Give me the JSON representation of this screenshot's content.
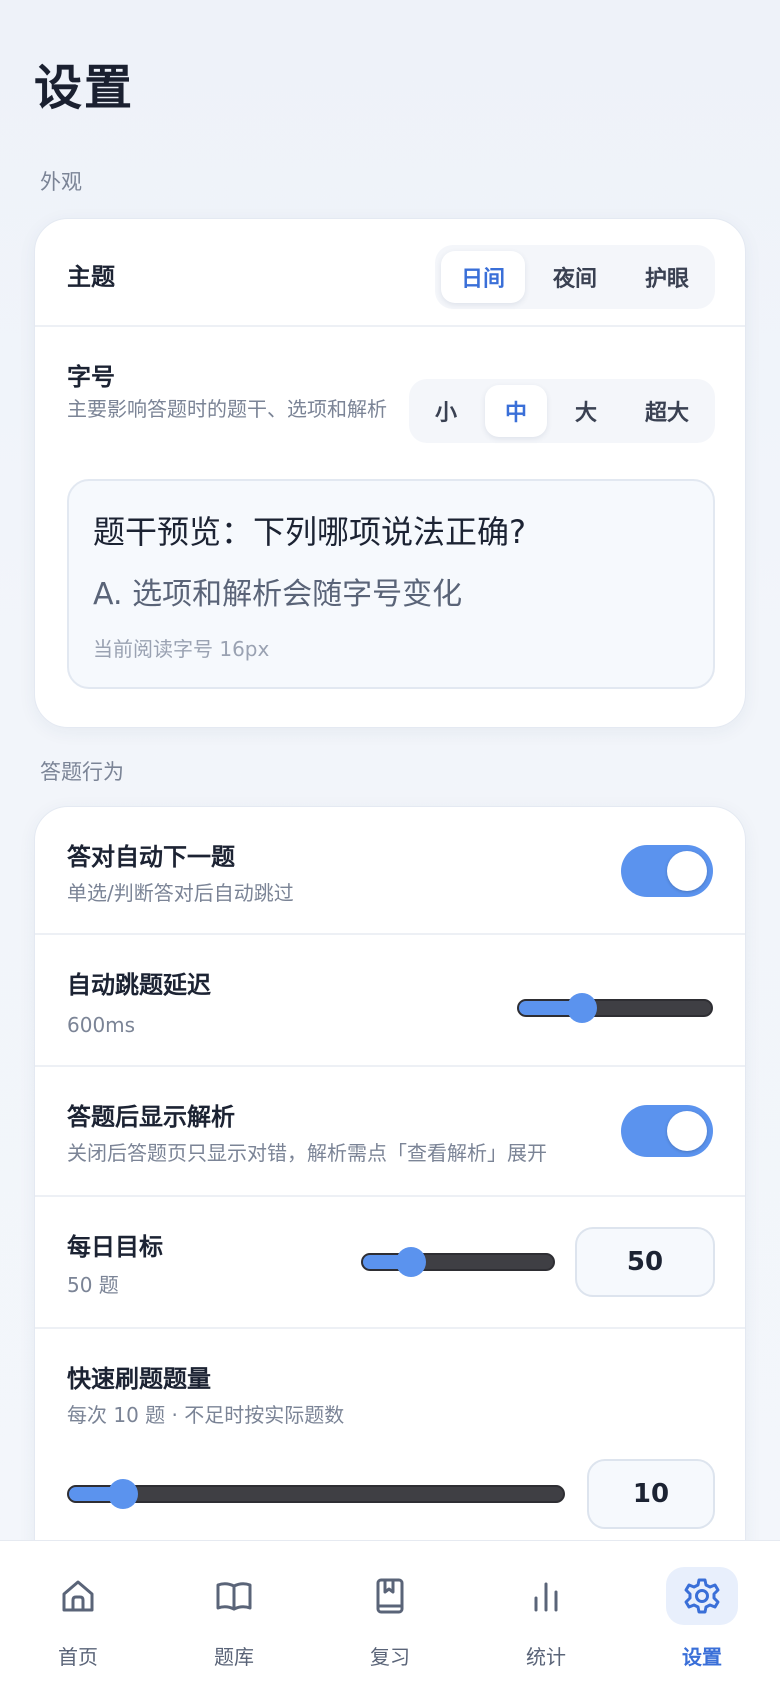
{
  "page": {
    "title": "设置"
  },
  "appearance": {
    "section_label": "外观",
    "theme": {
      "label": "主题",
      "options": [
        "日间",
        "夜间",
        "护眼"
      ],
      "selected": "日间"
    },
    "font_size": {
      "label": "字号",
      "description": "主要影响答题时的题干、选项和解析",
      "options": [
        "小",
        "中",
        "大",
        "超大"
      ],
      "selected": "中"
    },
    "preview": {
      "question": "题干预览：下列哪项说法正确?",
      "option": "A. 选项和解析会随字号变化",
      "note": "当前阅读字号 16px"
    }
  },
  "behavior": {
    "section_label": "答题行为",
    "auto_next": {
      "label": "答对自动下一题",
      "description": "单选/判断答对后自动跳过",
      "enabled": true
    },
    "auto_delay": {
      "label": "自动跳题延迟",
      "value_text": "600ms",
      "level": 0.33
    },
    "show_explanation": {
      "label": "答题后显示解析",
      "description": "关闭后答题页只显示对错，解析需点「查看解析」展开",
      "enabled": true
    },
    "daily_goal": {
      "label": "每日目标",
      "value_text": "50 题",
      "value": "50",
      "level": 0.25
    },
    "quick_count": {
      "label": "快速刷题题量",
      "description": "每次 10 题 · 不足时按实际题数",
      "value": "10",
      "level": 0.11
    }
  },
  "tabbar": {
    "items": [
      {
        "label": "首页",
        "icon": "home-icon"
      },
      {
        "label": "题库",
        "icon": "book-open-icon"
      },
      {
        "label": "复习",
        "icon": "bookmark-book-icon"
      },
      {
        "label": "统计",
        "icon": "bar-chart-icon"
      },
      {
        "label": "设置",
        "icon": "gear-icon",
        "active": true
      }
    ]
  },
  "colors": {
    "accent": "#5b93ee",
    "active_text": "#3a6fd8"
  }
}
